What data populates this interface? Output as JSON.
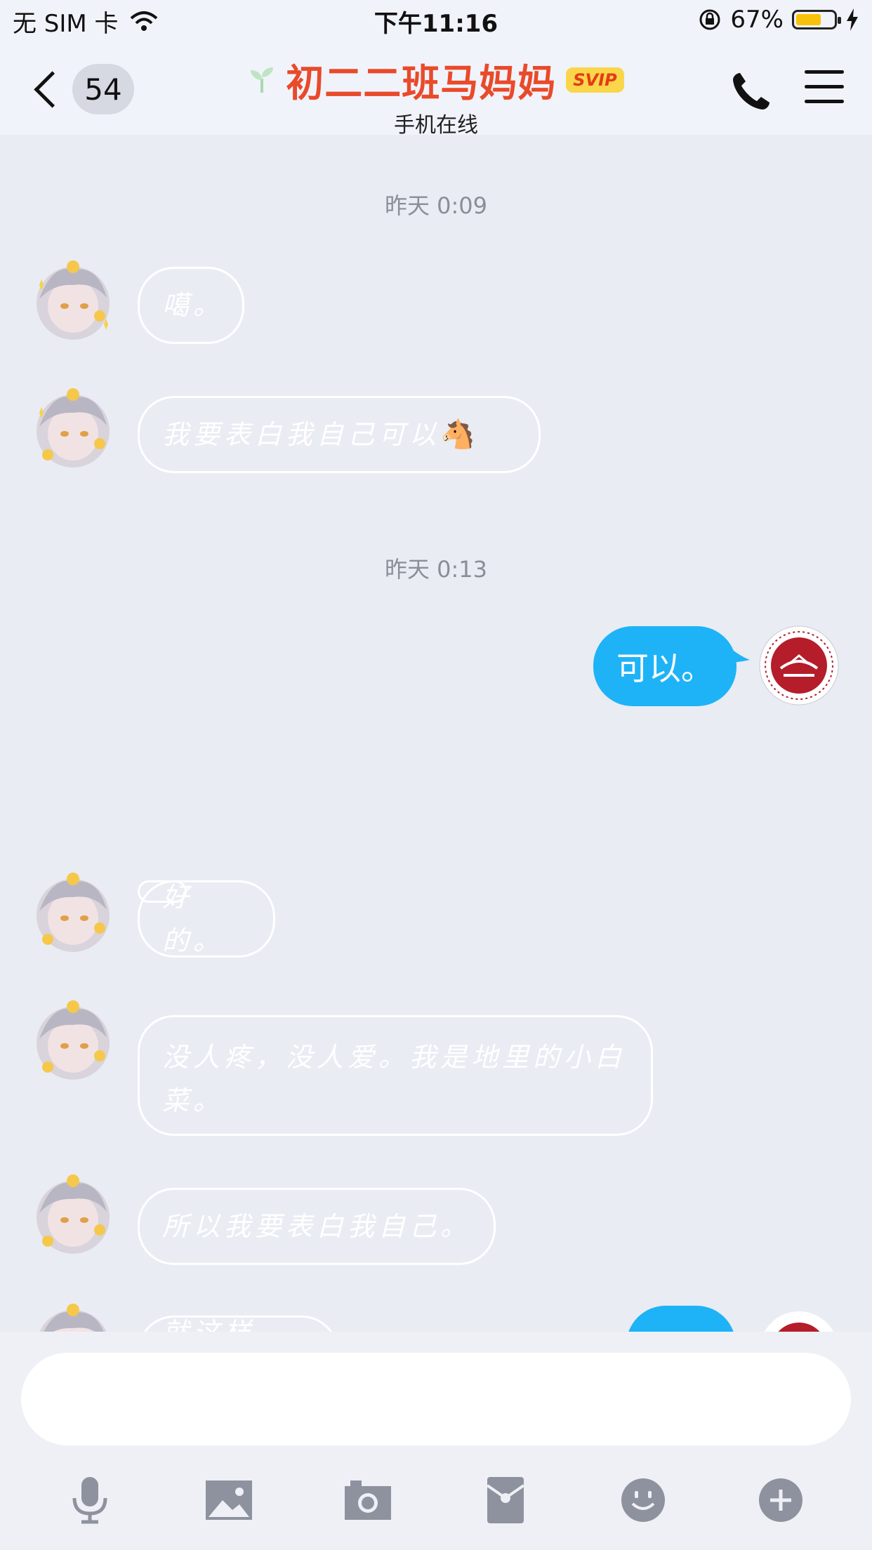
{
  "status_bar": {
    "carrier": "无 SIM 卡",
    "time": "下午11:16",
    "battery_percent": "67%",
    "battery_level": 0.67,
    "battery_color": "#f7c20b"
  },
  "nav": {
    "unread_count": "54",
    "contact_name": "初二二班马妈妈",
    "badge": "SVIP",
    "status": "手机在线",
    "name_color": "#e94a2a"
  },
  "messages": {
    "ts1": "昨天 0:09",
    "m1": "噶。",
    "m2": "我要表白我自己可以",
    "m2_emoji": "🐴",
    "ts2": "昨天 0:13",
    "m3": "可以。",
    "m4": "好的。",
    "m5_line1": "没人疼，没人爱。我是地里的小白",
    "m5_line2": "菜。",
    "m6": "所以我要表白我自己。",
    "m7": "就这样啦。",
    "m8": ""
  },
  "toolbar": {
    "items": [
      "microphone-icon",
      "image-icon",
      "camera-icon",
      "red-packet-icon",
      "emoji-icon",
      "plus-icon"
    ],
    "icon_color": "#8e929e"
  },
  "colors": {
    "bubble_blue": "#1eb3f6",
    "background": "#e9ecf3"
  }
}
